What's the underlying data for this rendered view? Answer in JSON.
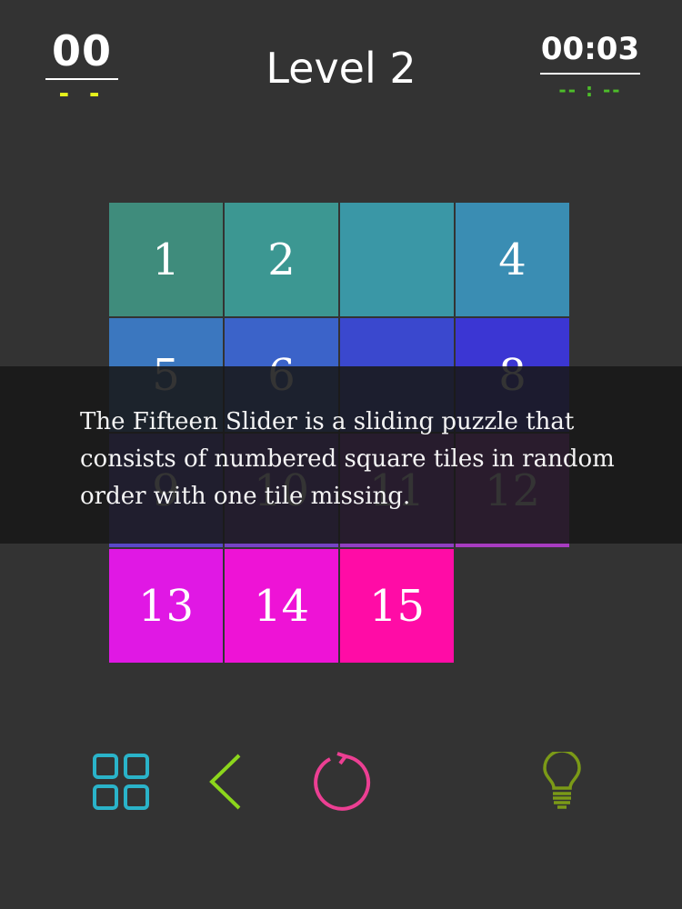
{
  "header": {
    "moves": "00",
    "best_moves": "- -",
    "level_title": "Level 2",
    "time": "00:03",
    "best_time": "-- : --"
  },
  "board": {
    "tiles": [
      {
        "label": "1",
        "color": "#3f8c7c"
      },
      {
        "label": "2",
        "color": "#3c9792"
      },
      {
        "label": "",
        "color": "#3a97a6"
      },
      {
        "label": "4",
        "color": "#3a8db3"
      },
      {
        "label": "5",
        "color": "#3b77bf"
      },
      {
        "label": "6",
        "color": "#3b63c9"
      },
      {
        "label": "",
        "color": "#3a48ce"
      },
      {
        "label": "8",
        "color": "#3b36d3"
      },
      {
        "label": "9",
        "color": "#5a48c8"
      },
      {
        "label": "10",
        "color": "#7643c5"
      },
      {
        "label": "11",
        "color": "#913fc3"
      },
      {
        "label": "12",
        "color": "#a83cc0"
      },
      {
        "label": "13",
        "color": "#e018e4"
      },
      {
        "label": "14",
        "color": "#ee13d6"
      },
      {
        "label": "15",
        "color": "#ff0ca6"
      },
      {
        "label": "",
        "color": ""
      }
    ]
  },
  "overlay": {
    "text": "The Fifteen Slider is a sliding puzzle that consists of numbered square tiles in random order with one tile missing."
  },
  "toolbar": {
    "icons": [
      "grid-icon",
      "back-icon",
      "restart-icon",
      "hint-icon"
    ],
    "colors": {
      "grid": "#2ab3c9",
      "back": "#8cd61c",
      "restart": "#ec3f93",
      "hint": "#7b9a17"
    }
  }
}
